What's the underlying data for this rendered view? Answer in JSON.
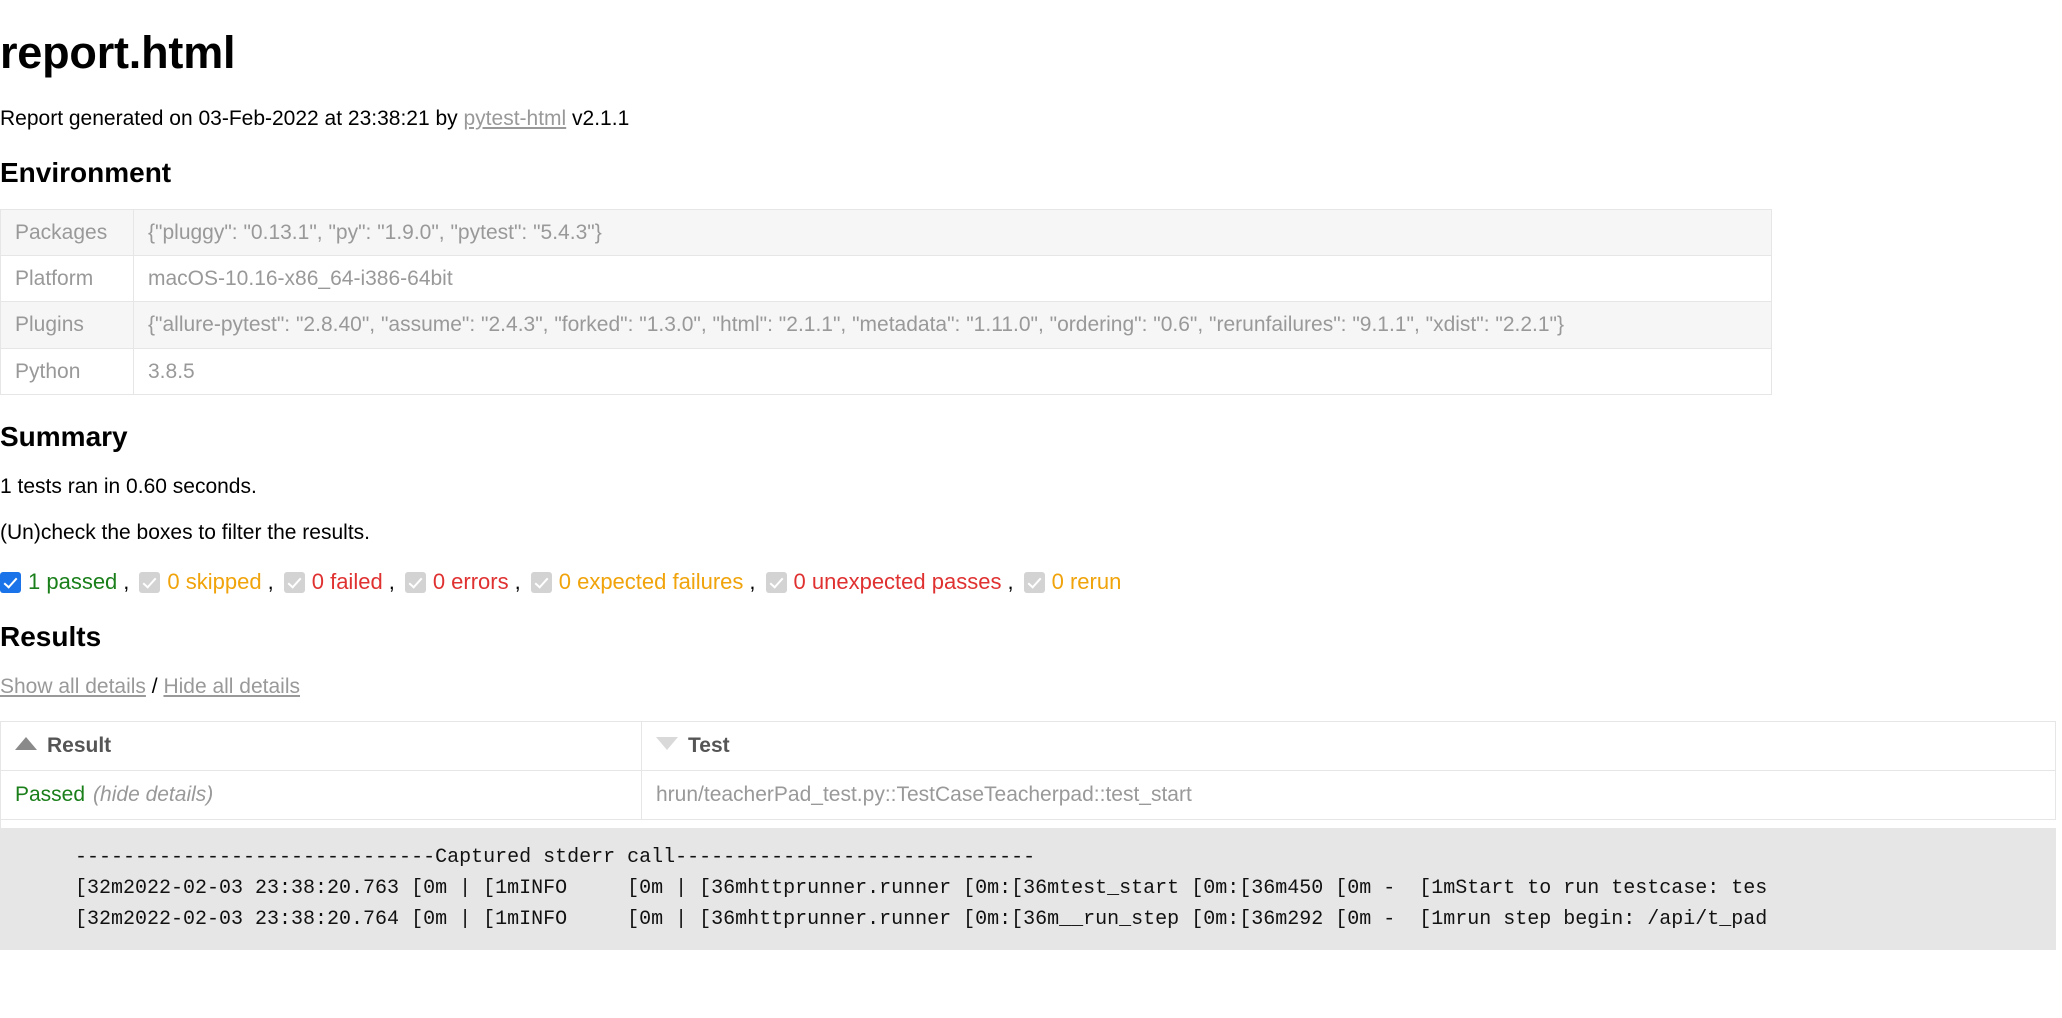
{
  "header": {
    "title": "report.html",
    "generated_prefix": "Report generated on 03-Feb-2022 at 23:38:21 by ",
    "generator_link": "pytest-html",
    "generator_version": " v2.1.1"
  },
  "environment": {
    "heading": "Environment",
    "rows": [
      {
        "key": "Packages",
        "value": "{\"pluggy\": \"0.13.1\", \"py\": \"1.9.0\", \"pytest\": \"5.4.3\"}"
      },
      {
        "key": "Platform",
        "value": "macOS-10.16-x86_64-i386-64bit"
      },
      {
        "key": "Plugins",
        "value": "{\"allure-pytest\": \"2.8.40\", \"assume\": \"2.4.3\", \"forked\": \"1.3.0\", \"html\": \"2.1.1\", \"metadata\": \"1.11.0\", \"ordering\": \"0.6\", \"rerunfailures\": \"9.1.1\", \"xdist\": \"2.2.1\"}"
      },
      {
        "key": "Python",
        "value": "3.8.5"
      }
    ]
  },
  "summary": {
    "heading": "Summary",
    "run_line": "1 tests ran in 0.60 seconds.",
    "filter_hint": "(Un)check the boxes to filter the results.",
    "filters": [
      {
        "label": "1 passed",
        "checked": true,
        "color": "#1a7f1a",
        "trailing": ","
      },
      {
        "label": "0 skipped",
        "checked": false,
        "color": "#f0a30a",
        "trailing": ","
      },
      {
        "label": "0 failed",
        "checked": false,
        "color": "#e03131",
        "trailing": ","
      },
      {
        "label": "0 errors",
        "checked": false,
        "color": "#e03131",
        "trailing": ","
      },
      {
        "label": "0 expected failures",
        "checked": false,
        "color": "#f0a30a",
        "trailing": ","
      },
      {
        "label": "0 unexpected passes",
        "checked": false,
        "color": "#e03131",
        "trailing": ","
      },
      {
        "label": "0 rerun",
        "checked": false,
        "color": "#f0a30a",
        "trailing": ""
      }
    ]
  },
  "results": {
    "heading": "Results",
    "show_all": "Show all details",
    "separator": " / ",
    "hide_all": "Hide all details",
    "columns": [
      {
        "label": "Result",
        "sort": "asc"
      },
      {
        "label": "Test",
        "sort": "desc"
      }
    ],
    "rows": [
      {
        "result": "Passed",
        "toggle": "(hide details)",
        "test": "hrun/teacherPad_test.py::TestCaseTeacherpad::test_start",
        "log": "    ------------------------------Captured stderr call------------------------------\n    \u001b[32m2022-02-03 23:38:20.763 \u001b[0m | \u001b[1mINFO     \u001b[0m | \u001b[36mhttprunner.runner \u001b[0m:\u001b[36mtest_start \u001b[0m:\u001b[36m450 \u001b[0m -  \u001b[1mStart to run testcase: tes\n    \u001b[32m2022-02-03 23:38:20.764 \u001b[0m | \u001b[1mINFO     \u001b[0m | \u001b[36mhttprunner.runner \u001b[0m:\u001b[36m__run_step \u001b[0m:\u001b[36m292 \u001b[0m -  \u001b[1mrun step begin: /api/t_pad"
      }
    ]
  }
}
